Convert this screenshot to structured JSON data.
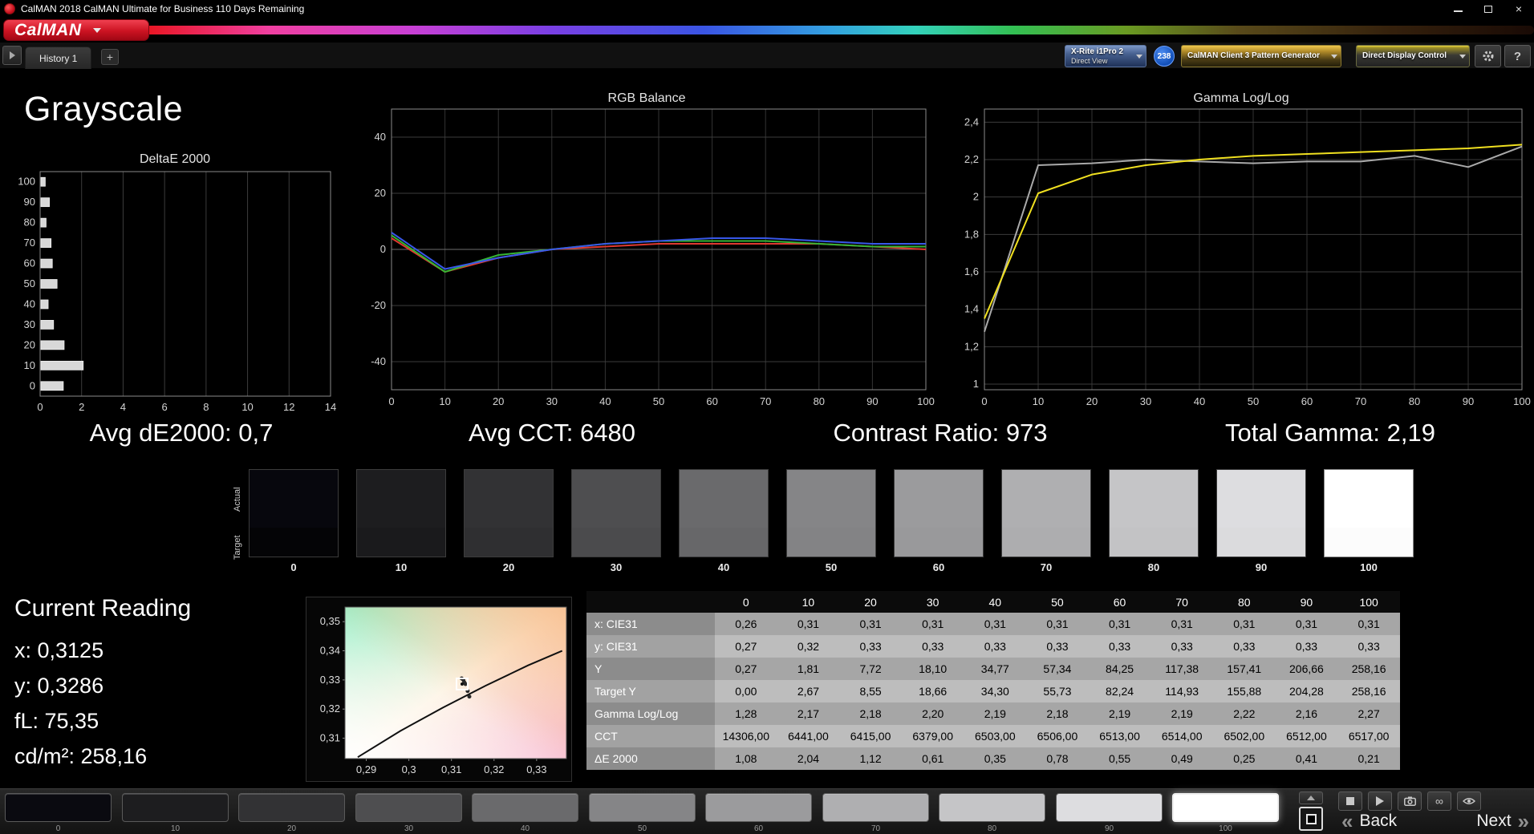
{
  "window": {
    "title": "CalMAN 2018 CalMAN Ultimate for Business 110 Days Remaining",
    "close_glyph": "×"
  },
  "logo": {
    "text": "CalMAN"
  },
  "tabbar": {
    "history_tab": "History 1",
    "add_tab": "+",
    "meter": {
      "line1": "X-Rite i1Pro 2",
      "line2": "Direct View"
    },
    "meter_badge": "238",
    "pattern_generator": "CalMAN Client 3 Pattern Generator",
    "display_control": "Direct Display Control",
    "help": "?"
  },
  "page": {
    "title": "Grayscale"
  },
  "stats": [
    {
      "label": "Avg dE2000: 0,7"
    },
    {
      "label": "Avg CCT: 6480"
    },
    {
      "label": "Contrast Ratio: 973"
    },
    {
      "label": "Total Gamma: 2,19"
    }
  ],
  "swatch_strip": {
    "row_labels": [
      "Actual",
      "Target"
    ],
    "levels": [
      "0",
      "10",
      "20",
      "30",
      "40",
      "50",
      "60",
      "70",
      "80",
      "90",
      "100"
    ],
    "actual_colors": [
      "#07070d",
      "#1d1d1f",
      "#323234",
      "#4e4e50",
      "#6a6a6c",
      "#858587",
      "#9b9b9d",
      "#afafb1",
      "#c5c5c7",
      "#dddde0",
      "#ffffff"
    ],
    "target_colors": [
      "#040406",
      "#1a1a1c",
      "#2f2f31",
      "#4b4b4d",
      "#676769",
      "#838385",
      "#99999b",
      "#adadaf",
      "#c3c3c5",
      "#dbdbdd",
      "#fcfcfc"
    ]
  },
  "current_reading": {
    "title": "Current Reading",
    "x": "x: 0,3125",
    "y": "y: 0,3286",
    "fl": "fL: 75,35",
    "cdm2": "cd/m²: 258,16"
  },
  "results_table": {
    "columns": [
      "0",
      "10",
      "20",
      "30",
      "40",
      "50",
      "60",
      "70",
      "80",
      "90",
      "100"
    ],
    "rows": [
      {
        "label": "x: CIE31",
        "values": [
          "0,26",
          "0,31",
          "0,31",
          "0,31",
          "0,31",
          "0,31",
          "0,31",
          "0,31",
          "0,31",
          "0,31",
          "0,31"
        ]
      },
      {
        "label": "y: CIE31",
        "values": [
          "0,27",
          "0,32",
          "0,33",
          "0,33",
          "0,33",
          "0,33",
          "0,33",
          "0,33",
          "0,33",
          "0,33",
          "0,33"
        ]
      },
      {
        "label": "Y",
        "values": [
          "0,27",
          "1,81",
          "7,72",
          "18,10",
          "34,77",
          "57,34",
          "84,25",
          "117,38",
          "157,41",
          "206,66",
          "258,16"
        ]
      },
      {
        "label": "Target Y",
        "values": [
          "0,00",
          "2,67",
          "8,55",
          "18,66",
          "34,30",
          "55,73",
          "82,24",
          "114,93",
          "155,88",
          "204,28",
          "258,16"
        ]
      },
      {
        "label": "Gamma Log/Log",
        "values": [
          "1,28",
          "2,17",
          "2,18",
          "2,20",
          "2,19",
          "2,18",
          "2,19",
          "2,19",
          "2,22",
          "2,16",
          "2,27"
        ]
      },
      {
        "label": "CCT",
        "values": [
          "14306,00",
          "6441,00",
          "6415,00",
          "6379,00",
          "6503,00",
          "6506,00",
          "6513,00",
          "6514,00",
          "6502,00",
          "6512,00",
          "6517,00"
        ]
      },
      {
        "label": "ΔE 2000",
        "values": [
          "1,08",
          "2,04",
          "1,12",
          "0,61",
          "0,35",
          "0,78",
          "0,55",
          "0,49",
          "0,25",
          "0,41",
          "0,21"
        ]
      }
    ]
  },
  "bottom_bar": {
    "levels": [
      "0",
      "10",
      "20",
      "30",
      "40",
      "50",
      "60",
      "70",
      "80",
      "90",
      "100"
    ],
    "colors": [
      "#0a0a10",
      "#1d1d1f",
      "#323234",
      "#4e4e50",
      "#6a6a6c",
      "#858587",
      "#9b9b9d",
      "#afafb1",
      "#c5c5c7",
      "#dddde0",
      "#ffffff"
    ],
    "selected_level": "100",
    "loop_glyph": "∞",
    "back_chevron": "«",
    "next_chevron": "»",
    "back_label": "Back",
    "next_label": "Next"
  },
  "chart_data": [
    {
      "id": "deltaE",
      "type": "bar",
      "title": "DeltaE 2000",
      "orientation": "horizontal",
      "categories": [
        "100",
        "90",
        "80",
        "70",
        "60",
        "50",
        "40",
        "30",
        "20",
        "10",
        "0"
      ],
      "values": [
        0.21,
        0.41,
        0.25,
        0.49,
        0.55,
        0.78,
        0.35,
        0.61,
        1.12,
        2.04,
        1.08
      ],
      "xlim": [
        0,
        14
      ],
      "xticks": [
        0,
        2,
        4,
        6,
        8,
        10,
        12,
        14
      ],
      "bar_color": "#d8d8d8"
    },
    {
      "id": "rgb",
      "type": "line",
      "title": "RGB Balance",
      "x": [
        0,
        10,
        20,
        30,
        40,
        50,
        60,
        70,
        80,
        90,
        100
      ],
      "xlim": [
        0,
        100
      ],
      "ylim": [
        -50,
        50
      ],
      "xticks": [
        0,
        10,
        20,
        30,
        40,
        50,
        60,
        70,
        80,
        90,
        100
      ],
      "yticks": [
        -40,
        -20,
        0,
        20,
        40
      ],
      "ytick_labels": [
        "-40",
        "-20",
        "0",
        "20",
        "40"
      ],
      "series": [
        {
          "name": "Red",
          "color": "#e03a30",
          "values": [
            4,
            -8,
            -3,
            0,
            1,
            2,
            2,
            2,
            2,
            1,
            0
          ]
        },
        {
          "name": "Green",
          "color": "#35b535",
          "values": [
            5,
            -8,
            -2,
            0,
            2,
            3,
            3,
            3,
            2,
            1,
            1
          ]
        },
        {
          "name": "Blue",
          "color": "#3858e8",
          "values": [
            6,
            -7,
            -3,
            0,
            2,
            3,
            4,
            4,
            3,
            2,
            2
          ]
        }
      ]
    },
    {
      "id": "gamma",
      "type": "line",
      "title": "Gamma Log/Log",
      "x": [
        0,
        10,
        20,
        30,
        40,
        50,
        60,
        70,
        80,
        90,
        100
      ],
      "xlim": [
        0,
        100
      ],
      "ylim": [
        0.97,
        2.47
      ],
      "xticks": [
        0,
        10,
        20,
        30,
        40,
        50,
        60,
        70,
        80,
        90,
        100
      ],
      "yticks": [
        1,
        1.2,
        1.4,
        1.6,
        1.8,
        2,
        2.2,
        2.4
      ],
      "ytick_labels": [
        "1",
        "1,2",
        "1,4",
        "1,6",
        "1,8",
        "2",
        "2,2",
        "2,4"
      ],
      "series": [
        {
          "name": "Measured",
          "color": "#aaaaaa",
          "values": [
            1.28,
            2.17,
            2.18,
            2.2,
            2.19,
            2.18,
            2.19,
            2.19,
            2.22,
            2.16,
            2.27
          ]
        },
        {
          "name": "Smoothed",
          "color": "#f0e020",
          "values": [
            1.35,
            2.02,
            2.12,
            2.17,
            2.2,
            2.22,
            2.23,
            2.24,
            2.25,
            2.26,
            2.28
          ]
        }
      ]
    },
    {
      "id": "cie",
      "type": "scatter",
      "title": "CIE xy Detail",
      "xlim": [
        0.285,
        0.337
      ],
      "ylim": [
        0.303,
        0.355
      ],
      "xticks": [
        0.29,
        0.3,
        0.31,
        0.32,
        0.33
      ],
      "xtick_labels": [
        "0,29",
        "0,3",
        "0,31",
        "0,32",
        "0,33"
      ],
      "yticks": [
        0.31,
        0.32,
        0.33,
        0.34,
        0.35
      ],
      "ytick_labels": [
        "0,31",
        "0,32",
        "0,33",
        "0,34",
        "0,35"
      ],
      "locus": [
        [
          0.288,
          0.3035
        ],
        [
          0.298,
          0.3125
        ],
        [
          0.308,
          0.3205
        ],
        [
          0.318,
          0.328
        ],
        [
          0.328,
          0.335
        ],
        [
          0.336,
          0.34
        ]
      ],
      "points": [
        [
          0.313,
          0.3292
        ],
        [
          0.3128,
          0.33
        ],
        [
          0.3133,
          0.3286
        ],
        [
          0.3138,
          0.3262
        ],
        [
          0.3142,
          0.3243
        ],
        [
          0.3124,
          0.3305
        ]
      ],
      "marker": [
        0.3125,
        0.3286
      ]
    }
  ]
}
